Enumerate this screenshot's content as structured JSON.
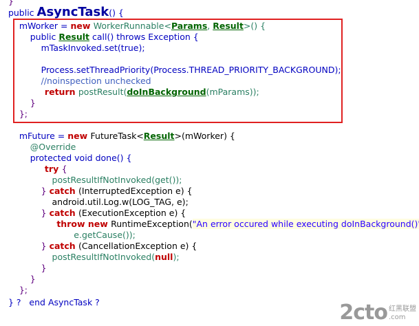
{
  "lines": [
    {
      "segments": [
        {
          "cls": "brace",
          "text": "  }"
        }
      ]
    },
    {
      "segments": [
        {
          "cls": "bluekw",
          "text": "  public "
        },
        {
          "cls": "title",
          "text": "AsyncTask"
        },
        {
          "cls": "bluekw",
          "text": "() {"
        }
      ]
    },
    {
      "segments": [
        {
          "cls": "field",
          "text": "      mWorker = "
        },
        {
          "cls": "kwred",
          "text": "new "
        },
        {
          "cls": "teal",
          "text": "WorkerRunnable<"
        },
        {
          "cls": "green",
          "text": "Params"
        },
        {
          "cls": "teal",
          "text": ", "
        },
        {
          "cls": "green",
          "text": "Result"
        },
        {
          "cls": "teal",
          "text": ">() {"
        }
      ]
    },
    {
      "segments": [
        {
          "cls": "bluekw",
          "text": "          public "
        },
        {
          "cls": "green",
          "text": "Result"
        },
        {
          "cls": "bluekw",
          "text": " call() throws Exception {"
        }
      ]
    },
    {
      "segments": [
        {
          "cls": "field",
          "text": "              mTaskInvoked.set(true);"
        }
      ]
    },
    {
      "segments": [
        {
          "cls": "field",
          "text": ""
        }
      ]
    },
    {
      "segments": [
        {
          "cls": "field",
          "text": "              Process.setThreadPriority(Process.THREAD_PRIORITY_BACKGROUND);"
        }
      ]
    },
    {
      "segments": [
        {
          "cls": "comment",
          "text": "              //noinspection unchecked"
        }
      ]
    },
    {
      "segments": [
        {
          "cls": "kwred",
          "text": "              return "
        },
        {
          "cls": "teal",
          "text": "postResult("
        },
        {
          "cls": "green",
          "text": "doInBackground"
        },
        {
          "cls": "teal",
          "text": "(mParams));"
        }
      ]
    },
    {
      "segments": [
        {
          "cls": "brace",
          "text": "          }"
        }
      ]
    },
    {
      "segments": [
        {
          "cls": "brace",
          "text": "      };"
        }
      ]
    },
    {
      "segments": [
        {
          "cls": "field",
          "text": ""
        }
      ]
    },
    {
      "segments": [
        {
          "cls": "field",
          "text": "      mFuture = "
        },
        {
          "cls": "kwred",
          "text": "new "
        },
        {
          "cls": "method",
          "text": "FutureTask<"
        },
        {
          "cls": "green",
          "text": "Result"
        },
        {
          "cls": "method",
          "text": ">(mWorker) {"
        }
      ]
    },
    {
      "segments": [
        {
          "cls": "teal",
          "text": "          @Override"
        }
      ]
    },
    {
      "segments": [
        {
          "cls": "bluekw",
          "text": "          protected void done() {"
        }
      ]
    },
    {
      "segments": [
        {
          "cls": "kwred",
          "text": "              try "
        },
        {
          "cls": "brace",
          "text": "{"
        }
      ]
    },
    {
      "segments": [
        {
          "cls": "teal",
          "text": "                  postResultIfNotInvoked(get());"
        }
      ]
    },
    {
      "segments": [
        {
          "cls": "brace",
          "text": "              } "
        },
        {
          "cls": "kwred",
          "text": "catch "
        },
        {
          "cls": "method",
          "text": "(InterruptedException e) {"
        }
      ]
    },
    {
      "segments": [
        {
          "cls": "method",
          "text": "                  android.util.Log.w(LOG_TAG, e);"
        }
      ]
    },
    {
      "segments": [
        {
          "cls": "brace",
          "text": "              } "
        },
        {
          "cls": "kwred",
          "text": "catch "
        },
        {
          "cls": "method",
          "text": "(ExecutionException e) {"
        }
      ]
    },
    {
      "segments": [
        {
          "cls": "kwred",
          "text": "                  throw new "
        },
        {
          "cls": "method",
          "text": "RuntimeException("
        },
        {
          "cls": "str",
          "text": "\"An error occured while executing doInBackground()\""
        },
        {
          "cls": "method",
          "text": ","
        }
      ]
    },
    {
      "segments": [
        {
          "cls": "teal",
          "text": "                          e.getCause());"
        }
      ]
    },
    {
      "segments": [
        {
          "cls": "brace",
          "text": "              } "
        },
        {
          "cls": "kwred",
          "text": "catch "
        },
        {
          "cls": "method",
          "text": "(CancellationException e) {"
        }
      ]
    },
    {
      "segments": [
        {
          "cls": "teal",
          "text": "                  postResultIfNotInvoked("
        },
        {
          "cls": "kwred",
          "text": "null"
        },
        {
          "cls": "teal",
          "text": ");"
        }
      ]
    },
    {
      "segments": [
        {
          "cls": "brace",
          "text": "              }"
        }
      ]
    },
    {
      "segments": [
        {
          "cls": "brace",
          "text": "          }"
        }
      ]
    },
    {
      "segments": [
        {
          "cls": "brace",
          "text": "      };"
        }
      ]
    },
    {
      "segments": [
        {
          "cls": "bluekw",
          "text": "  } ?   end AsyncTask ?"
        }
      ]
    }
  ],
  "watermark": {
    "logo": "2cto",
    "suffix": ".com",
    "side_top": "红黑联盟"
  }
}
